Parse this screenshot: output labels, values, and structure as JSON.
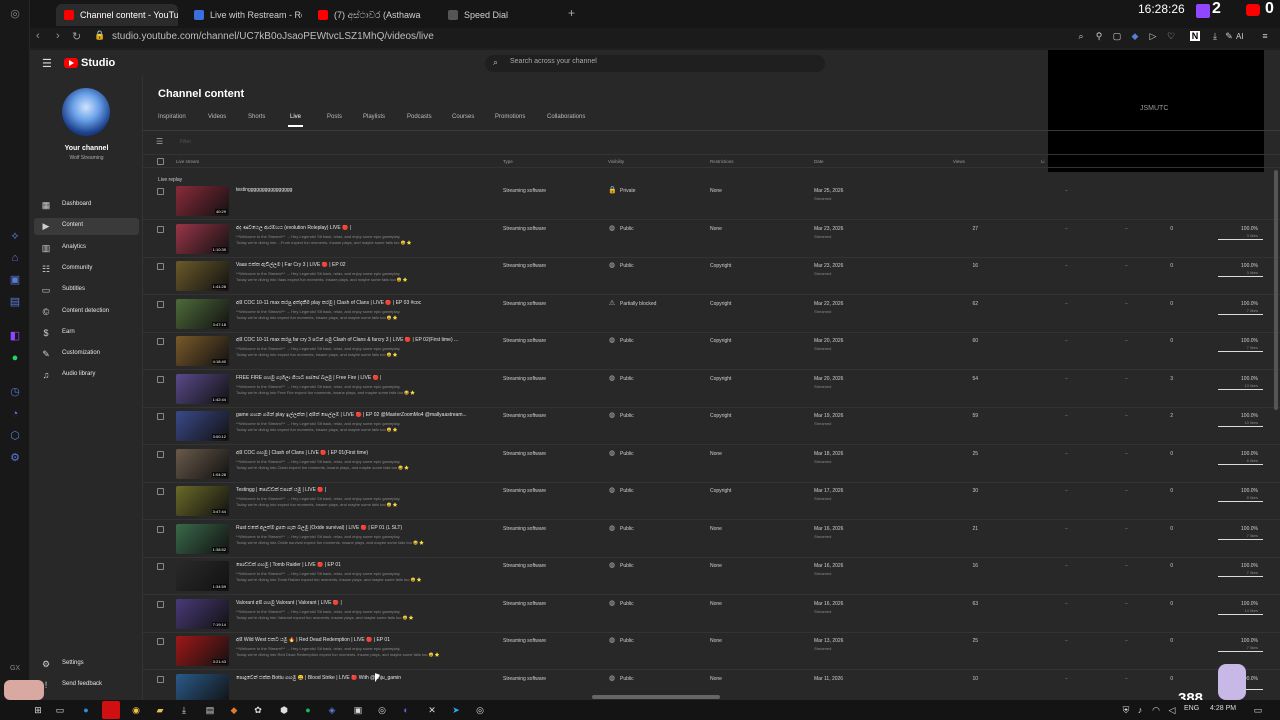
{
  "browser": {
    "tabs": [
      {
        "title": "Channel content - YouTube",
        "color": "#ff0000",
        "active": true
      },
      {
        "title": "Live with Restream - Resto",
        "color": "#3b6fe0",
        "active": false
      },
      {
        "title": "(7) අස්ථාවර (Asthawa",
        "color": "#ff0000",
        "active": false
      },
      {
        "title": "Speed Dial",
        "color": "#555555",
        "active": false
      }
    ],
    "new_tab": "+",
    "clock": "16:28:26",
    "url": "studio.youtube.com/channel/UC7kB0oJsaoPEWtvcLSZ1MhQ/videos/live",
    "ai_label": "AI"
  },
  "studio": {
    "logo_text": "Studio",
    "search_placeholder": "Search across your channel",
    "preview_text": "JSMUTC",
    "channel": {
      "title": "Your channel",
      "name": "Wolf Streaming"
    },
    "nav": [
      {
        "label": "Dashboard",
        "icon": "dashboard-icon",
        "active": false
      },
      {
        "label": "Content",
        "icon": "content-icon",
        "active": true
      },
      {
        "label": "Analytics",
        "icon": "analytics-icon",
        "active": false
      },
      {
        "label": "Community",
        "icon": "community-icon",
        "active": false
      },
      {
        "label": "Subtitles",
        "icon": "subtitles-icon",
        "active": false
      },
      {
        "label": "Content detection",
        "icon": "copyright-icon",
        "active": false
      },
      {
        "label": "Earn",
        "icon": "earn-icon",
        "active": false
      },
      {
        "label": "Customization",
        "icon": "customization-icon",
        "active": false
      },
      {
        "label": "Audio library",
        "icon": "audio-library-icon",
        "active": false
      }
    ],
    "bottom_nav": [
      {
        "label": "Settings",
        "icon": "settings-icon"
      },
      {
        "label": "Send feedback",
        "icon": "feedback-icon"
      }
    ],
    "page_title": "Channel content",
    "content_tabs": [
      "Inspiration",
      "Videos",
      "Shorts",
      "Live",
      "Posts",
      "Playlists",
      "Podcasts",
      "Courses",
      "Promotions",
      "Collaborations"
    ],
    "active_tab": "Live",
    "filter_placeholder": "Filter",
    "columns": {
      "video": "Live stream",
      "type": "Type",
      "visibility": "Visibility",
      "restrictions": "Restrictions",
      "date": "Date",
      "views": "Views",
      "likes": "Li"
    },
    "section_label": "Live replay",
    "rows": [
      {
        "title": "testingggggggggggggggg",
        "desc1": "",
        "desc2": "",
        "duration": "40:29",
        "type": "Streaming software",
        "visibility": "Private",
        "vis_icon": "lock-icon",
        "restrictions": "None",
        "date": "Mar 25, 2026",
        "date_sub": "Streamed",
        "views": "",
        "dash1": "–",
        "dash2": "",
        "comments": "",
        "likes": "",
        "likes_sub": "",
        "like_pct": 0,
        "thumb": "#8a2b3a"
      },
      {
        "title": "අද ණවයෙල ආරම්භය (evolution Roleplay) LIVE 🔴 |",
        "desc1": "**Welcome to the Stream!** → Hey Legends! Sit back, relax, and enjoy some epic gameplay.",
        "desc2": "Today we're diving into ...From expect fun moments, insane plays, and maybe some fails too 😅 ⭐",
        "duration": "1:10:39",
        "type": "Streaming software",
        "visibility": "Public",
        "vis_icon": "globe-icon",
        "restrictions": "None",
        "date": "Mar 23, 2026",
        "date_sub": "Streamed",
        "views": "27",
        "dash1": "–",
        "dash2": "–",
        "comments": "0",
        "likes": "100.0%",
        "likes_sub": "3 likes",
        "like_pct": 1,
        "thumb": "#9a3548"
      },
      {
        "title": "Vaas එක්ක ඇවිල්ලම | Far Cry 3 | LIVE 🔴 | EP 02",
        "desc1": "**Welcome to the Stream!** → Hey Legends! Sit back, relax, and enjoy some epic gameplay.",
        "desc2": "Today we're diving into Vaas expect fun moments, insane plays, and maybe some fails too 😅 ⭐",
        "duration": "1:41:28",
        "type": "Streaming software",
        "visibility": "Public",
        "vis_icon": "globe-icon",
        "restrictions": "Copyright",
        "date": "Mar 23, 2026",
        "date_sub": "Streamed",
        "views": "16",
        "dash1": "–",
        "dash2": "–",
        "comments": "0",
        "likes": "100.0%",
        "likes_sub": "3 likes",
        "like_pct": 1,
        "thumb": "#6b5a2a"
      },
      {
        "title": "අපි COC 10-11 max කරපු අත්දැකීම play කරමු | Clash of Clans | LIVE 🔴 | EP 03 #coc",
        "desc1": "**Welcome to the Stream!** → Hey Legends! Sit back, relax, and enjoy some epic gameplay.",
        "desc2": "Today we're diving into expect fun moments, insane plays, and maybe some fails too 😅 ⭐",
        "duration": "3:47:18",
        "type": "Streaming software",
        "visibility": "Partially blocked",
        "vis_icon": "warning-icon",
        "restrictions": "Copyright",
        "date": "Mar 22, 2026",
        "date_sub": "Streamed",
        "views": "62",
        "dash1": "–",
        "dash2": "–",
        "comments": "0",
        "likes": "100.0%",
        "likes_sub": "7 likes",
        "like_pct": 1,
        "thumb": "#4e6b3a"
      },
      {
        "title": "අපි COC 10-11 max කරපු far cry 3 පටන් ගමු Clash of Clans & farcry 3 | LIVE 🔴 | EP 02(First time) ...",
        "desc1": "**Welcome to the Stream!** → Hey Legends! Sit back, relax, and enjoy some epic gameplay.",
        "desc2": "Today we're diving into expect fun moments, insane plays, and maybe some fails too 😅 ⭐",
        "duration": "4:18:40",
        "type": "Streaming software",
        "visibility": "Public",
        "vis_icon": "globe-icon",
        "restrictions": "Copyright",
        "date": "Mar 20, 2026",
        "date_sub": "Streamed",
        "views": "60",
        "dash1": "–",
        "dash2": "–",
        "comments": "0",
        "likes": "100.0%",
        "likes_sub": "7 likes",
        "like_pct": 1,
        "thumb": "#7a5a2a"
      },
      {
        "title": "FREE FIRE ගහමු ගැහිලා ගියාට පස්සේ බලමු | Free Fire | LIVE 🔴 |",
        "desc1": "**Welcome to the Stream!** → Hey Legends! Sit back, relax, and enjoy some epic gameplay.",
        "desc2": "Today we're diving into Free Fire expect fun moments, insane plays, and maybe some fails too 😅 ⭐",
        "duration": "1:42:44",
        "type": "Streaming software",
        "visibility": "Public",
        "vis_icon": "globe-icon",
        "restrictions": "Copyright",
        "date": "Mar 20, 2026",
        "date_sub": "Streamed",
        "views": "54",
        "dash1": "–",
        "dash2": "–",
        "comments": "3",
        "likes": "100.0%",
        "likes_sub": "13 likes",
        "like_pct": 1,
        "thumb": "#5a4a8a"
      },
      {
        "title": "game ගහන ගමන් play ඉල්ලන්න | අපිත් සෙල්ලම් | LIVE 🔴 | EP 02 @MasterZoomMo4 @mallyaastream...",
        "desc1": "**Welcome to the Stream!** → Hey Legends! Sit back, relax, and enjoy some epic gameplay.",
        "desc2": "Today we're diving into expect fun moments, insane plays, and maybe some fails too 😅 ⭐",
        "duration": "3:00:12",
        "type": "Streaming software",
        "visibility": "Public",
        "vis_icon": "globe-icon",
        "restrictions": "Copyright",
        "date": "Mar 19, 2026",
        "date_sub": "Streamed",
        "views": "59",
        "dash1": "–",
        "dash2": "–",
        "comments": "2",
        "likes": "100.0%",
        "likes_sub": "10 likes",
        "like_pct": 1,
        "thumb": "#3a4a8a"
      },
      {
        "title": "අපි COC ගහමු | Clash of Clans | LIVE 🔴 | EP 01(First time)",
        "desc1": "**Welcome to the Stream!** → Hey Legends! Sit back, relax, and enjoy some epic gameplay.",
        "desc2": "Today we're diving into Clash expect fun moments, insane plays, and maybe some fails too 😅 ⭐",
        "duration": "1:04:28",
        "type": "Streaming software",
        "visibility": "Public",
        "vis_icon": "globe-icon",
        "restrictions": "None",
        "date": "Mar 18, 2026",
        "date_sub": "Streamed",
        "views": "25",
        "dash1": "–",
        "dash2": "–",
        "comments": "0",
        "likes": "100.0%",
        "likes_sub": "6 likes",
        "like_pct": 1,
        "thumb": "#6a5a4a"
      },
      {
        "title": "Testingg | පොඩ්ඩක් එපාන් යමු | LIVE 🔴 |",
        "desc1": "**Welcome to the Stream!** → Hey Legends! Sit back, relax, and enjoy some epic gameplay.",
        "desc2": "Today we're diving into expect fun moments, insane plays, and maybe some fails too 😅 ⭐",
        "duration": "3:47:44",
        "type": "Streaming software",
        "visibility": "Public",
        "vis_icon": "globe-icon",
        "restrictions": "Copyright",
        "date": "Mar 17, 2026",
        "date_sub": "Streamed",
        "views": "30",
        "dash1": "–",
        "dash2": "–",
        "comments": "0",
        "likes": "100.0%",
        "likes_sub": "8 likes",
        "like_pct": 1,
        "thumb": "#6a6a2a"
      },
      {
        "title": "Rust එකේ අලුත්ම දූපත ගැන බලමු (Oxide survival) | LIVE 🔴 | EP 01 (L SLT)",
        "desc1": "**Welcome to the Stream!** → Hey Legends! Sit back, relax, and enjoy some epic gameplay.",
        "desc2": "Today we're diving into Oxide survival expect fun moments, insane plays, and maybe some fails too 😅 ⭐",
        "duration": "1:38:52",
        "type": "Streaming software",
        "visibility": "Public",
        "vis_icon": "globe-icon",
        "restrictions": "None",
        "date": "Mar 16, 2026",
        "date_sub": "Streamed",
        "views": "21",
        "dash1": "–",
        "dash2": "–",
        "comments": "0",
        "likes": "100.0%",
        "likes_sub": "7 likes",
        "like_pct": 1,
        "thumb": "#3a6a4a"
      },
      {
        "title": "පොඩ්ඩක් ගහමු | Tomb Raider | LIVE 🔴 | EP 01",
        "desc1": "**Welcome to the Stream!** → Hey Legends! Sit back, relax, and enjoy some epic gameplay.",
        "desc2": "Today we're diving into Tomb Raider expect fun moments, insane plays, and maybe some fails too 😅 ⭐",
        "duration": "1:34:59",
        "type": "Streaming software",
        "visibility": "Public",
        "vis_icon": "globe-icon",
        "restrictions": "None",
        "date": "Mar 16, 2026",
        "date_sub": "Streamed",
        "views": "16",
        "dash1": "–",
        "dash2": "–",
        "comments": "0",
        "likes": "100.0%",
        "likes_sub": "7 likes",
        "like_pct": 1,
        "thumb": "#2a2a2a"
      },
      {
        "title": "Valorant අපි ගහමු Valorant | Valorant | LIVE 🔴 |",
        "desc1": "**Welcome to the Stream!** → Hey Legends! Sit back, relax, and enjoy some epic gameplay.",
        "desc2": "Today we're diving into Valorant expect fun moments, insane plays, and maybe some fails too 😅 ⭐",
        "duration": "7:19:14",
        "type": "Streaming software",
        "visibility": "Public",
        "vis_icon": "globe-icon",
        "restrictions": "None",
        "date": "Mar 16, 2026",
        "date_sub": "Streamed",
        "views": "63",
        "dash1": "–",
        "dash2": "–",
        "comments": "0",
        "likes": "100.0%",
        "likes_sub": "14 likes",
        "like_pct": 1,
        "thumb": "#4a3a7a"
      },
      {
        "title": "අපි Wild West එකට යමු 🔥 | Red Dead Redemption | LIVE 🔴 | EP 01",
        "desc1": "**Welcome to the Stream!** → Hey Legends! Sit back, relax, and enjoy some epic gameplay.",
        "desc2": "Today we're diving into Red Dead Redemption expect fun moments, insane plays, and maybe some fails too 😅 ⭐",
        "duration": "3:21:43",
        "type": "Streaming software",
        "visibility": "Public",
        "vis_icon": "globe-icon",
        "restrictions": "None",
        "date": "Mar 13, 2026",
        "date_sub": "Streamed",
        "views": "25",
        "dash1": "–",
        "dash2": "–",
        "comments": "0",
        "likes": "100.0%",
        "likes_sub": "7 likes",
        "like_pct": 1,
        "thumb": "#a01818"
      },
      {
        "title": "පොදුවෙන් එක්ක Bottu ගහමු 😄 | Blood Strike | LIVE 🔴 With @anju_gamin",
        "desc1": "",
        "desc2": "",
        "duration": "",
        "type": "Streaming software",
        "visibility": "Public",
        "vis_icon": "globe-icon",
        "restrictions": "None",
        "date": "Mar 11, 2026",
        "date_sub": "",
        "views": "10",
        "dash1": "–",
        "dash2": "–",
        "comments": "0",
        "likes": "100.0%",
        "likes_sub": "",
        "like_pct": 1,
        "thumb": "#2a5a8a"
      }
    ]
  },
  "overlays": {
    "twitch_count": "2",
    "yt_count": "0",
    "viewer_count": "388"
  },
  "taskbar": {
    "lang": "ENG",
    "time": "4:28 PM"
  }
}
